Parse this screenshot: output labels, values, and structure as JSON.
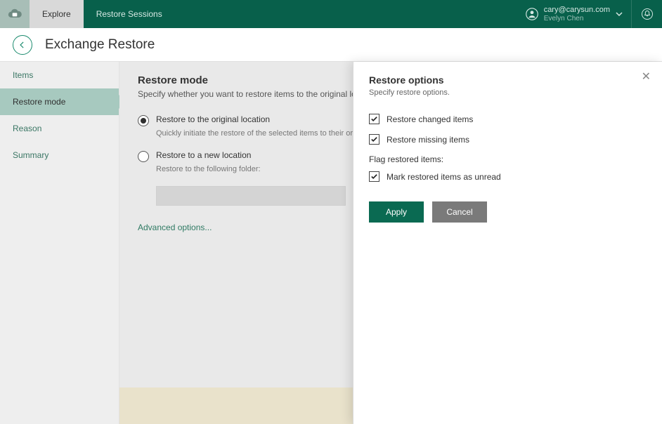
{
  "topbar": {
    "tabs": [
      {
        "label": "Explore",
        "active": true
      },
      {
        "label": "Restore Sessions",
        "active": false
      }
    ],
    "user_email": "cary@carysun.com",
    "user_name": "Evelyn Chen"
  },
  "title": "Exchange Restore",
  "sidenav": {
    "items": [
      {
        "label": "Items",
        "active": false
      },
      {
        "label": "Restore mode",
        "active": true
      },
      {
        "label": "Reason",
        "active": false
      },
      {
        "label": "Summary",
        "active": false
      }
    ]
  },
  "restore_mode": {
    "heading": "Restore mode",
    "subheading": "Specify whether you want to restore items to the original location or to a new location.",
    "opt_original_label": "Restore to the original location",
    "opt_original_desc": "Quickly initiate the restore of the selected items to their original location.",
    "opt_new_label": "Restore to a new location",
    "opt_new_desc": "Restore to the following folder:",
    "advanced_link": "Advanced options..."
  },
  "flyout": {
    "title": "Restore options",
    "subtitle": "Specify restore options.",
    "chk_changed": "Restore changed items",
    "chk_missing": "Restore missing items",
    "flag_label": "Flag restored items:",
    "chk_unread": "Mark restored items as unread",
    "apply": "Apply",
    "cancel": "Cancel"
  }
}
